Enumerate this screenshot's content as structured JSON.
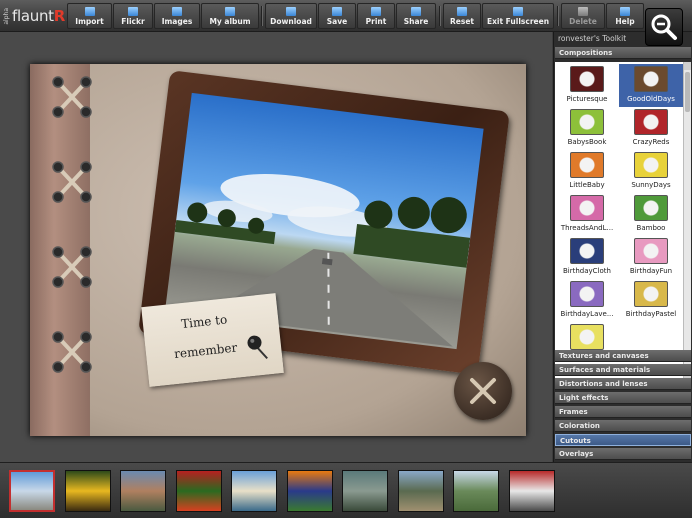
{
  "app": {
    "logo_small": "alpha",
    "logo_brand": "flaunt",
    "logo_brand_r": "R"
  },
  "toolbar": {
    "buttons": [
      {
        "label": "Import",
        "icon": "import-icon"
      },
      {
        "label": "Flickr",
        "icon": "flickr-icon"
      },
      {
        "label": "Images",
        "icon": "images-icon"
      },
      {
        "label": "My album",
        "icon": "album-icon"
      },
      {
        "label": "Download",
        "icon": "download-icon"
      },
      {
        "label": "Save",
        "icon": "save-icon"
      },
      {
        "label": "Print",
        "icon": "print-icon"
      },
      {
        "label": "Share",
        "icon": "share-icon"
      },
      {
        "label": "Reset",
        "icon": "reset-icon"
      },
      {
        "label": "Exit Fullscreen",
        "icon": "exit-fullscreen-icon"
      },
      {
        "label": "Delete",
        "icon": "delete-icon",
        "disabled": true
      },
      {
        "label": "Help",
        "icon": "help-icon"
      }
    ],
    "zoom_icon": "zoom-out-icon"
  },
  "canvas": {
    "note_line1": "Time to",
    "note_line2": "remember"
  },
  "toolkit": {
    "title": "ronvester's Toolkit",
    "sections_top": [
      "Compositions"
    ],
    "compositions": [
      {
        "label": "Picturesque",
        "color": "#5a1a1a"
      },
      {
        "label": "GoodOldDays",
        "color": "#6b4a2e",
        "selected": true
      },
      {
        "label": "BabysBook",
        "color": "#8dc03a"
      },
      {
        "label": "CrazyReds",
        "color": "#b0252a"
      },
      {
        "label": "LittleBaby",
        "color": "#e07a2a"
      },
      {
        "label": "SunnyDays",
        "color": "#e8d23a"
      },
      {
        "label": "ThreadsAndL...",
        "color": "#d56aa8"
      },
      {
        "label": "Bamboo",
        "color": "#4f9a3a"
      },
      {
        "label": "BirthdayCloth",
        "color": "#2a3e7a"
      },
      {
        "label": "BirthdayFun",
        "color": "#e89ac0"
      },
      {
        "label": "BirthdayLave...",
        "color": "#8a6ac0"
      },
      {
        "label": "BirthdayPastel",
        "color": "#d8b84a"
      },
      {
        "label": "",
        "color": "#e8e060"
      }
    ],
    "sections_bottom": [
      {
        "label": "Textures and canvases"
      },
      {
        "label": "Surfaces and materials"
      },
      {
        "label": "Distortions and lenses"
      },
      {
        "label": "Light effects"
      },
      {
        "label": "Frames"
      },
      {
        "label": "Coloration"
      },
      {
        "label": "Cutouts",
        "active": true
      },
      {
        "label": "Overlays"
      }
    ]
  },
  "filmstrip": [
    {
      "name": "road-thumbnail",
      "colors": [
        "#5f9ad8",
        "#c8d8e8",
        "#8a8a80"
      ],
      "selected": true
    },
    {
      "name": "sunflower-thumbnail",
      "colors": [
        "#2d4a1a",
        "#e8b820",
        "#3a2a10"
      ]
    },
    {
      "name": "people-thumbnail",
      "colors": [
        "#6a8ab0",
        "#b08060",
        "#4a5a40"
      ]
    },
    {
      "name": "peppers-thumbnail",
      "colors": [
        "#b82020",
        "#2a6a20",
        "#d84020"
      ]
    },
    {
      "name": "beach-thumbnail",
      "colors": [
        "#6aa0d8",
        "#e8e0c8",
        "#3a6a8a"
      ]
    },
    {
      "name": "flower-thumbnail",
      "colors": [
        "#e87a10",
        "#2a3a8a",
        "#3a7a30"
      ]
    },
    {
      "name": "ducks-thumbnail",
      "colors": [
        "#5a7a7a",
        "#8a9a90",
        "#3a4a3a"
      ]
    },
    {
      "name": "carriage-thumbnail",
      "colors": [
        "#8aa8c8",
        "#5a6a50",
        "#a09070"
      ]
    },
    {
      "name": "landscape-thumbnail",
      "colors": [
        "#c8d8e8",
        "#6a8a5a",
        "#4a6a3a"
      ]
    },
    {
      "name": "car-thumbnail",
      "colors": [
        "#b82a2a",
        "#e8e8e8",
        "#4a4a4a"
      ]
    }
  ]
}
